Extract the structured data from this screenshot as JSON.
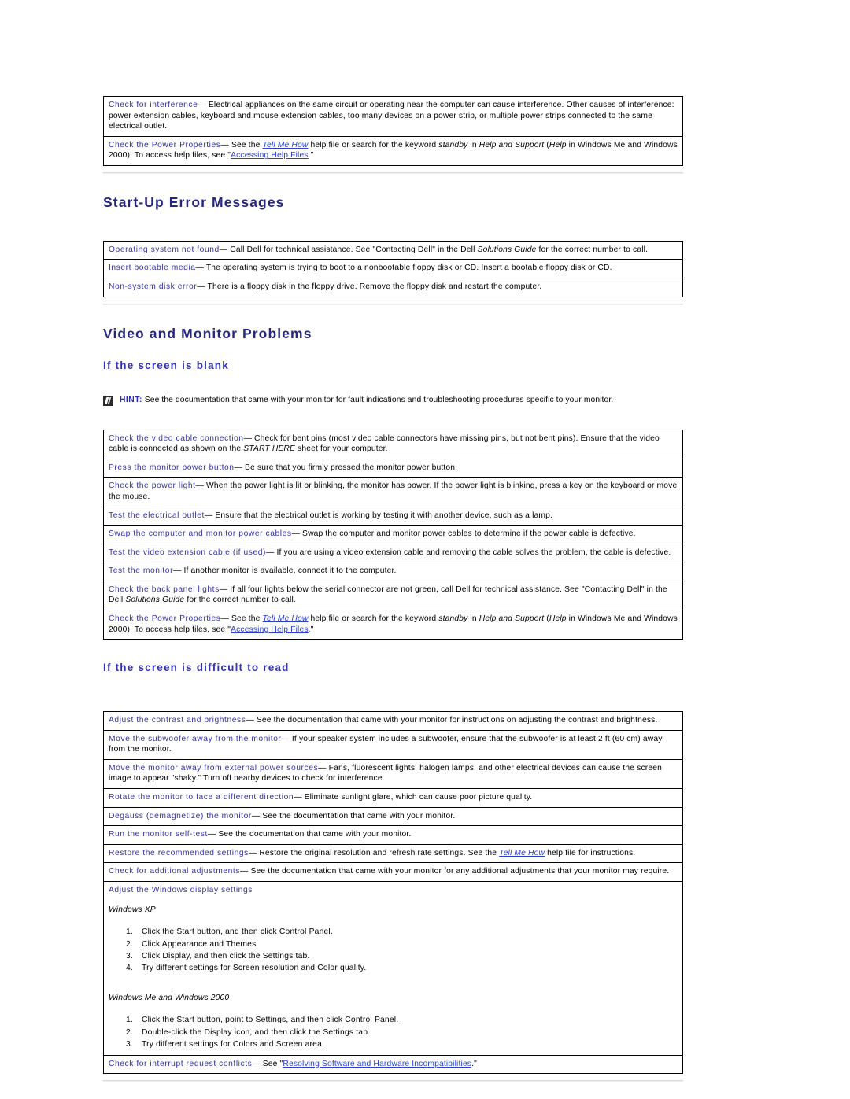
{
  "colors": {
    "heading": "#27277f",
    "subheading": "#3333b0",
    "term": "#3333a6",
    "link": "#2a3fd0",
    "border": "#000000",
    "rule": "#d9d9d9"
  },
  "top_table": {
    "rows": [
      {
        "term": "Check for interference",
        "dash": "—",
        "text": " Electrical appliances on the same circuit or operating near the computer can cause interference. Other causes of interference: power extension cables, keyboard and mouse extension cables, too many devices on a power strip, or multiple power strips connected to the same electrical outlet."
      },
      {
        "term": "Check the Power Properties",
        "dash": "—",
        "text_pre": " See the ",
        "link1": "Tell Me How",
        "text_mid1": " help file or search for the keyword ",
        "ital1": "standby",
        "text_mid2": " in ",
        "ital2": "Help and Support",
        "text_mid3": " (",
        "ital3": "Help",
        "text_mid4": " in Windows Me and Windows 2000). To access help files, see \"",
        "link2": "Accessing Help Files",
        "text_post": ".\""
      }
    ]
  },
  "section_startup": {
    "heading": "Start-Up Error Messages",
    "rows": [
      {
        "term": "Operating system not found",
        "dash": "—",
        "text_pre": " Call Dell for technical assistance. See \"Contacting Dell\" in the Dell ",
        "ital": "Solutions Guide",
        "text_post": " for the correct number to call."
      },
      {
        "term": "Insert bootable media",
        "dash": "—",
        "text": " The operating system is trying to boot to a nonbootable floppy disk or CD. Insert a bootable floppy disk or CD."
      },
      {
        "term": "Non-system disk error",
        "dash": "—",
        "text": " There is a floppy disk in the floppy drive. Remove the floppy disk and restart the computer."
      }
    ]
  },
  "section_video": {
    "heading": "Video and Monitor Problems",
    "sub1": "If the screen is blank",
    "hint": {
      "label": "HINT:",
      "text": " See the documentation that came with your monitor for fault indications and troubleshooting procedures specific to your monitor."
    },
    "blank_rows": [
      {
        "term": "Check the video cable connection",
        "dash": "—",
        "text_pre": " Check for bent pins (most video cable connectors have missing pins, but not bent pins). Ensure that the video cable is connected as shown on the ",
        "ital": "START HERE",
        "text_post": " sheet for your computer."
      },
      {
        "term": "Press the monitor power button",
        "dash": "—",
        "text": " Be sure that you firmly pressed the monitor power button."
      },
      {
        "term": "Check the power light",
        "dash": "—",
        "text": " When the power light is lit or blinking, the monitor has power. If the power light is blinking, press a key on the keyboard or move the mouse."
      },
      {
        "term": "Test the electrical outlet",
        "dash": "—",
        "text": " Ensure that the electrical outlet is working by testing it with another device, such as a lamp."
      },
      {
        "term": "Swap the computer and monitor power cables",
        "dash": "—",
        "text": " Swap the computer and monitor power cables to determine if the power cable is defective."
      },
      {
        "term": "Test the video extension cable (if used)",
        "dash": "—",
        "text": " If you are using a video extension cable and removing the cable solves the problem, the cable is defective."
      },
      {
        "term": "Test the monitor",
        "dash": "—",
        "text": " If another monitor is available, connect it to the computer."
      },
      {
        "term": "Check the back panel lights",
        "dash": "—",
        "text_pre": " If all four lights below the serial connector are not green, call Dell for technical assistance. See \"Contacting Dell\" in the Dell ",
        "ital": "Solutions Guide",
        "text_post": " for the correct number to call."
      },
      {
        "term": "Check the Power Properties",
        "dash": "—",
        "text_pre": " See the ",
        "link1": "Tell Me How",
        "text_mid1": " help file or search for the keyword ",
        "ital1": "standby",
        "text_mid2": " in ",
        "ital2": "Help and Support",
        "text_mid3": " (",
        "ital3": "Help",
        "text_mid4": " in Windows Me and Windows 2000). To access help files, see \"",
        "link2": "Accessing Help Files",
        "text_post": ".\""
      }
    ],
    "sub2": "If the screen is difficult to read",
    "difficult_rows": [
      {
        "term": "Adjust the contrast and brightness",
        "dash": "—",
        "text": " See the documentation that came with your monitor for instructions on adjusting the contrast and brightness."
      },
      {
        "term": "Move the subwoofer away from the monitor",
        "dash": "—",
        "text": " If your speaker system includes a subwoofer, ensure that the subwoofer is at least 2 ft (60 cm) away from the monitor."
      },
      {
        "term": "Move the monitor away from external power sources",
        "dash": "—",
        "text": " Fans, fluorescent lights, halogen lamps, and other electrical devices can cause the screen image to appear \"shaky.\" Turn off nearby devices to check for interference."
      },
      {
        "term": "Rotate the monitor to face a different direction",
        "dash": "—",
        "text": " Eliminate sunlight glare, which can cause poor picture quality."
      },
      {
        "term": "Degauss (demagnetize) the monitor",
        "dash": "—",
        "text": " See the documentation that came with your monitor."
      },
      {
        "term": "Run the monitor self-test",
        "dash": "—",
        "text": " See the documentation that came with your monitor."
      },
      {
        "term": "Restore the recommended settings",
        "dash": "—",
        "text_pre": " Restore the original resolution and refresh rate settings. See the ",
        "link1": "Tell Me How",
        "text_post": " help file for instructions."
      },
      {
        "term": "Check for additional adjustments",
        "dash": "—",
        "text": " See the documentation that came with your monitor for any additional adjustments that your monitor may require."
      }
    ],
    "display_settings": {
      "term": "Adjust the Windows display settings",
      "xp_title": "Windows XP",
      "xp_steps": [
        "Click the Start button, and then click Control Panel.",
        "Click Appearance and Themes.",
        "Click Display, and then click the Settings tab.",
        "Try different settings for Screen resolution and Color quality."
      ],
      "me2000_title": "Windows Me and Windows 2000",
      "me2000_steps": [
        "Click the Start button, point to Settings, and then click Control Panel.",
        "Double-click the Display icon, and then click the Settings tab.",
        "Try different settings for Colors and Screen area."
      ]
    },
    "final_row": {
      "term": "Check for interrupt request conflicts",
      "dash": "—",
      "text_pre": " See \"",
      "link1": "Resolving Software and Hardware Incompatibilities",
      "text_post": ".\""
    }
  }
}
